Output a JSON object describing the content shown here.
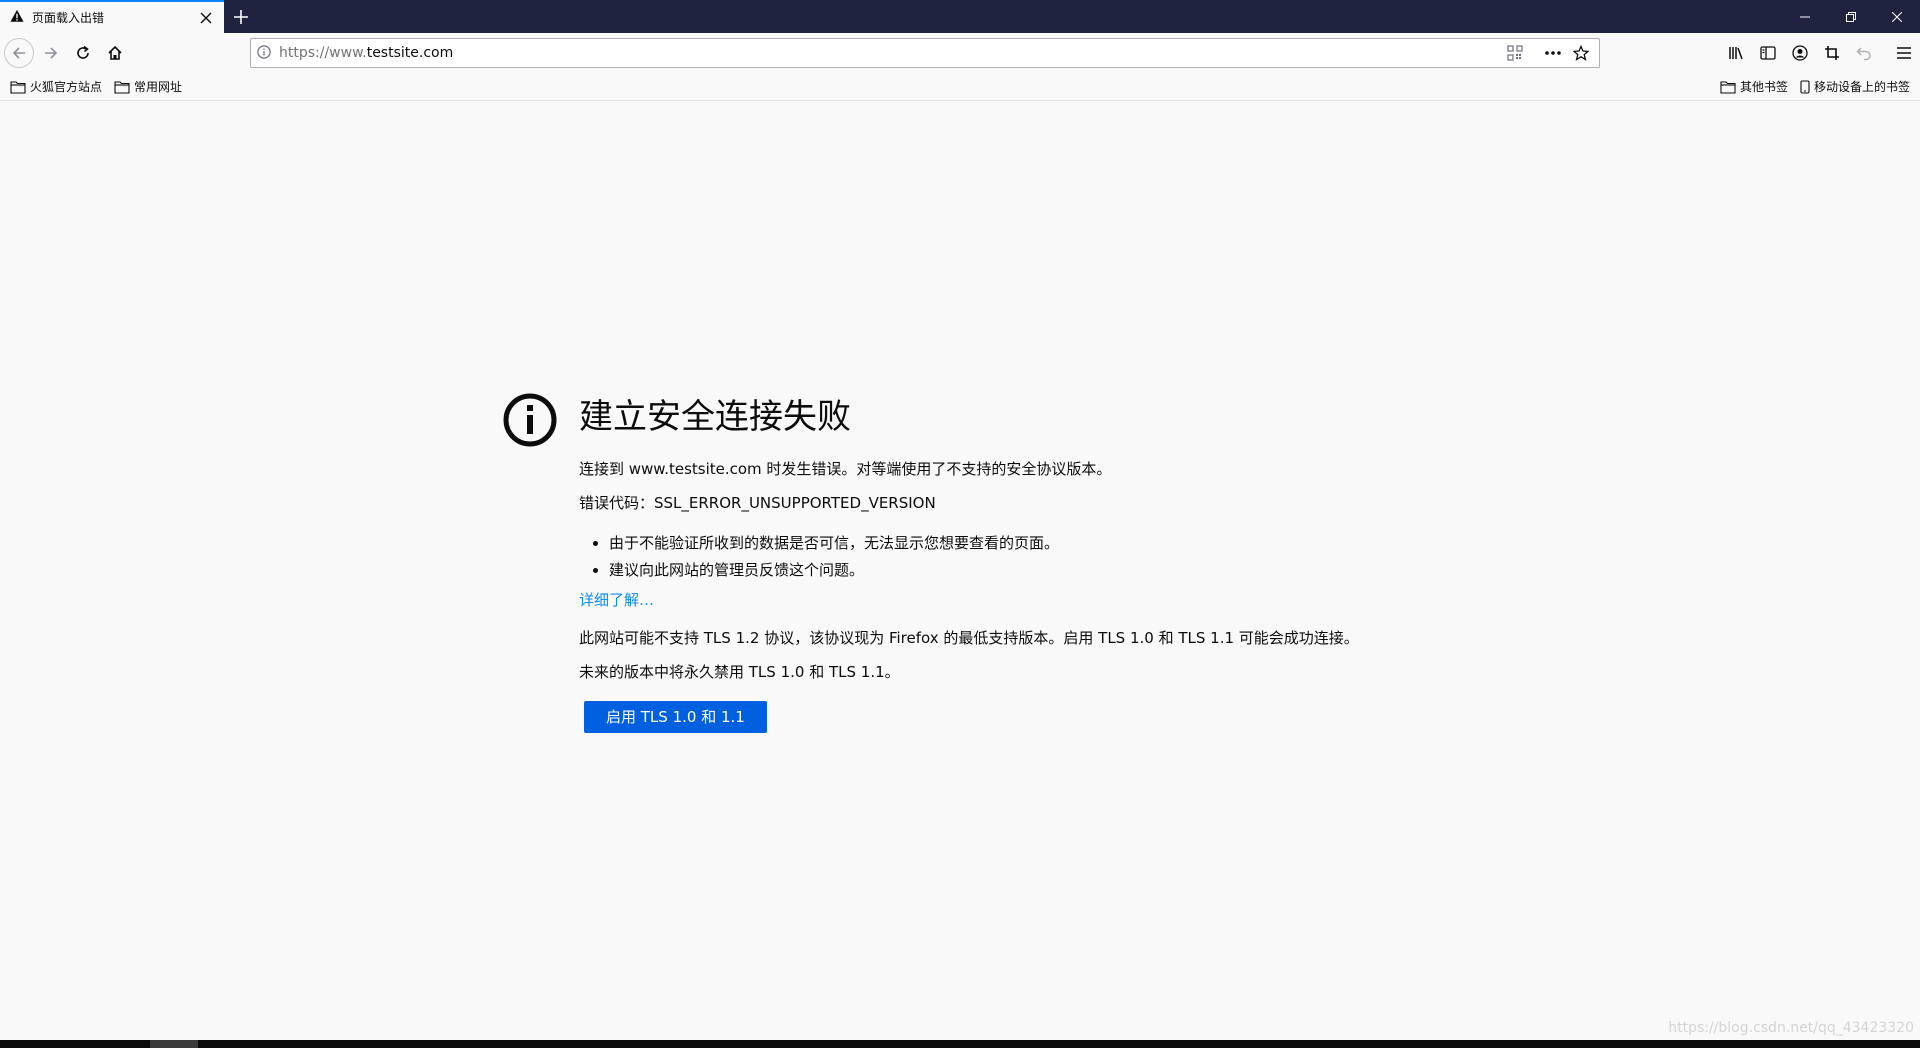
{
  "tab": {
    "title": "页面载入出错"
  },
  "urlbar": {
    "scheme": "https://www.",
    "host": "testsite.com"
  },
  "bookmarks": {
    "left": [
      {
        "label": "火狐官方站点"
      },
      {
        "label": "常用网址"
      }
    ],
    "right": [
      {
        "label": "其他书签"
      },
      {
        "label": "移动设备上的书签"
      }
    ]
  },
  "error": {
    "title": "建立安全连接失败",
    "line1": "连接到 www.testsite.com 时发生错误。对等端使用了不支持的安全协议版本。",
    "code": "错误代码：SSL_ERROR_UNSUPPORTED_VERSION",
    "bullets": [
      "由于不能验证所收到的数据是否可信，无法显示您想要查看的页面。",
      "建议向此网站的管理员反馈这个问题。"
    ],
    "learn_more": "详细了解…",
    "tls_note": "此网站可能不支持 TLS 1.2 协议，该协议现为 Firefox 的最低支持版本。启用 TLS 1.0 和 TLS 1.1 可能会成功连接。",
    "tls_future": "未来的版本中将永久禁用 TLS 1.0 和 TLS 1.1。",
    "button": "启用 TLS 1.0 和 1.1"
  },
  "watermark": "https://blog.csdn.net/qq_43423320",
  "colors": {
    "accent": "#0060df",
    "link": "#0a8dff",
    "tabbar": "#202340"
  }
}
